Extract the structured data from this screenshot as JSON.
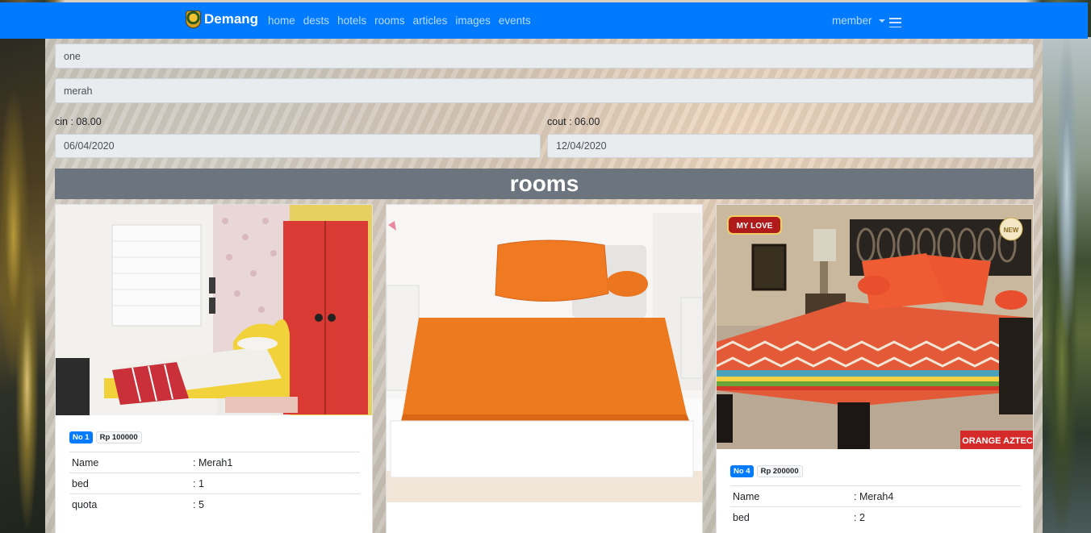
{
  "navbar": {
    "brand": "Demang",
    "links": [
      "home",
      "dests",
      "hotels",
      "rooms",
      "articles",
      "images",
      "events"
    ],
    "member": "member"
  },
  "form": {
    "field1": "one",
    "field2": "merah",
    "cin_label": "cin : 08.00",
    "cout_label": "cout : 06.00",
    "cin_date": "06/04/2020",
    "cout_date": "12/04/2020"
  },
  "rooms": {
    "title": "rooms",
    "cards": [
      {
        "no": "No 1",
        "price": "Rp 100000",
        "rows": [
          {
            "key": "Name",
            "value": ": Merah1"
          },
          {
            "key": "bed",
            "value": ": 1"
          },
          {
            "key": "quota",
            "value": ": 5"
          }
        ]
      },
      {
        "no": "",
        "price": "",
        "rows": []
      },
      {
        "no": "No 4",
        "price": "Rp 200000",
        "brand_mark": "MY LOVE",
        "product_label": "ORANGE AZTEC",
        "new_mark": "NEW",
        "rows": [
          {
            "key": "Name",
            "value": ": Merah4"
          },
          {
            "key": "bed",
            "value": ": 2"
          }
        ]
      }
    ]
  },
  "colors": {
    "navbar": "#007bff",
    "header": "#6c757d",
    "badge": "#007bff"
  }
}
